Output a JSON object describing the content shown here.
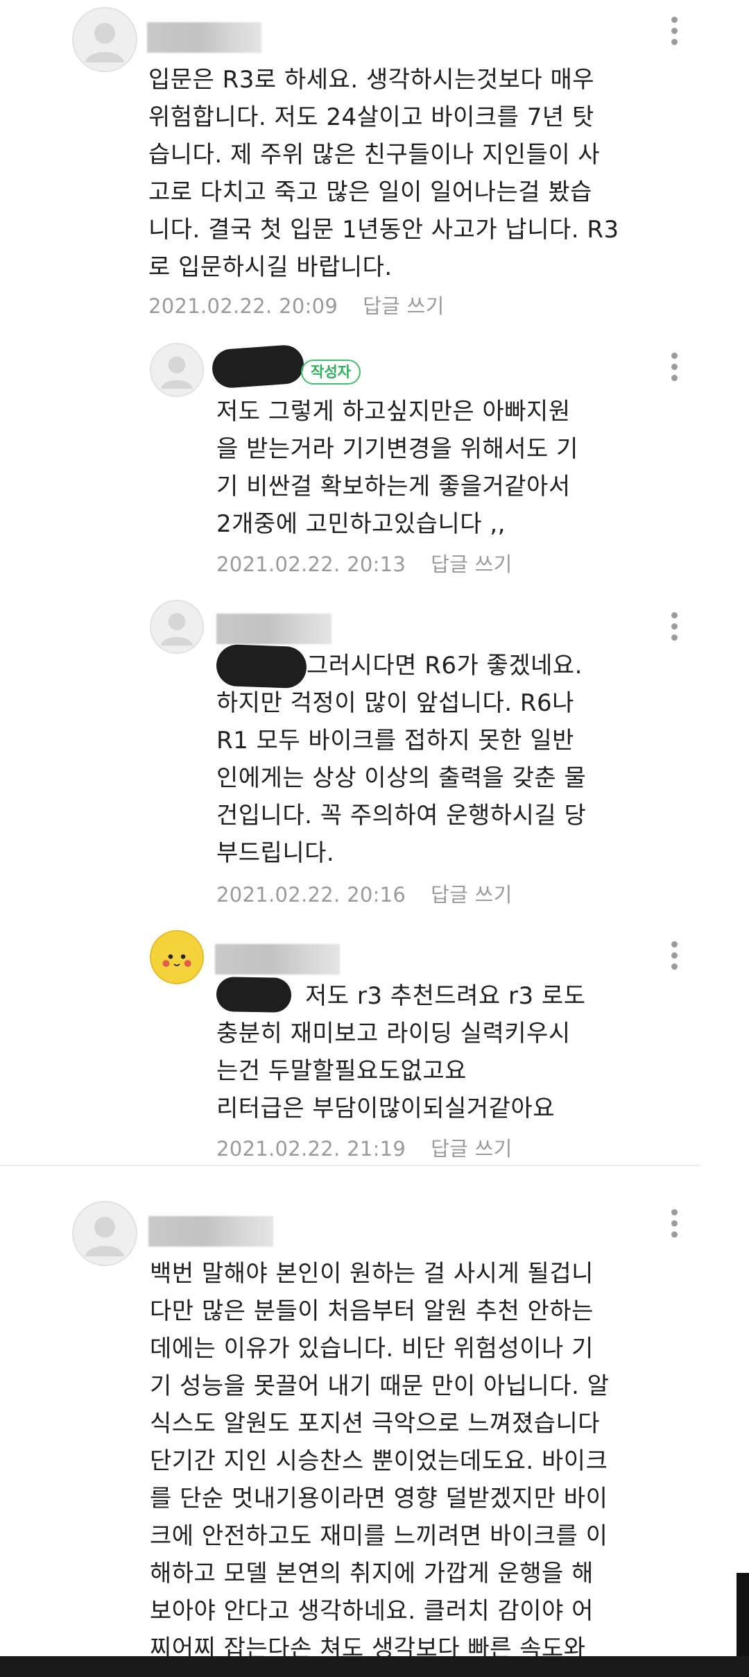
{
  "comments": [
    {
      "text": "입문은 R3로 하세요. 생각하시는것보다 매우\n위험합니다. 저도 24살이고 바이크를 7년 탓\n습니다. 제 주위 많은 친구들이나 지인들이 사\n고로 다치고 죽고 많은 일이 일어나는걸 봤습\n니다. 결국 첫 입문 1년동안 사고가 납니다. R3\n로 입문하시길 바랍니다.",
      "date": "2021.02.22. 20:09",
      "reply_label": "답글 쓰기"
    },
    {
      "badge": "작성자",
      "text": "저도 그렇게 하고싶지만은 아빠지원\n을 받는거라 기기변경을 위해서도 기\n기 비싼걸 확보하는게 좋을거같아서\n2개중에 고민하고있습니다 ,,",
      "date": "2021.02.22. 20:13",
      "reply_label": "답글 쓰기"
    },
    {
      "text": "그러시다면 R6가 좋겠네요.\n하지만 걱정이 많이 앞섭니다. R6나\nR1 모두 바이크를 접하지 못한 일반\n인에게는 상상 이상의 출력을 갖춘 물\n건입니다. 꼭 주의하여 운행하시길 당\n부드립니다.",
      "date": "2021.02.22. 20:16",
      "reply_label": "답글 쓰기"
    },
    {
      "text": "저도 r3 추천드려요 r3 로도\n충분히 재미보고 라이딩 실력키우시\n는건 두말할필요도없고요\n리터급은 부담이많이되실거같아요",
      "date": "2021.02.22. 21:19",
      "reply_label": "답글 쓰기"
    },
    {
      "text": "백번 말해야 본인이 원하는 걸 사시게 될겁니\n다만 많은 분들이 처음부터 알원 추천 안하는\n데에는 이유가 있습니다. 비단 위험성이나 기\n기 성능을 못끌어 내기 때문 만이 아닙니다. 알\n식스도 알원도 포지션 극악으로 느껴졌습니다\n단기간 지인 시승찬스 뿐이었는데도요. 바이크\n를 단순 멋내기용이라면 영향 덜받겠지만 바이\n크에 안전하고도 재미를 느끼려면 바이크를 이\n해하고 모델 본연의 취지에 가깝게 운행을 해\n보아야 안다고 생각하네요. 클러치 감이야 어\n찌어찌 잡는다손 쳐도 생각보다 빠른 속도와"
    }
  ]
}
